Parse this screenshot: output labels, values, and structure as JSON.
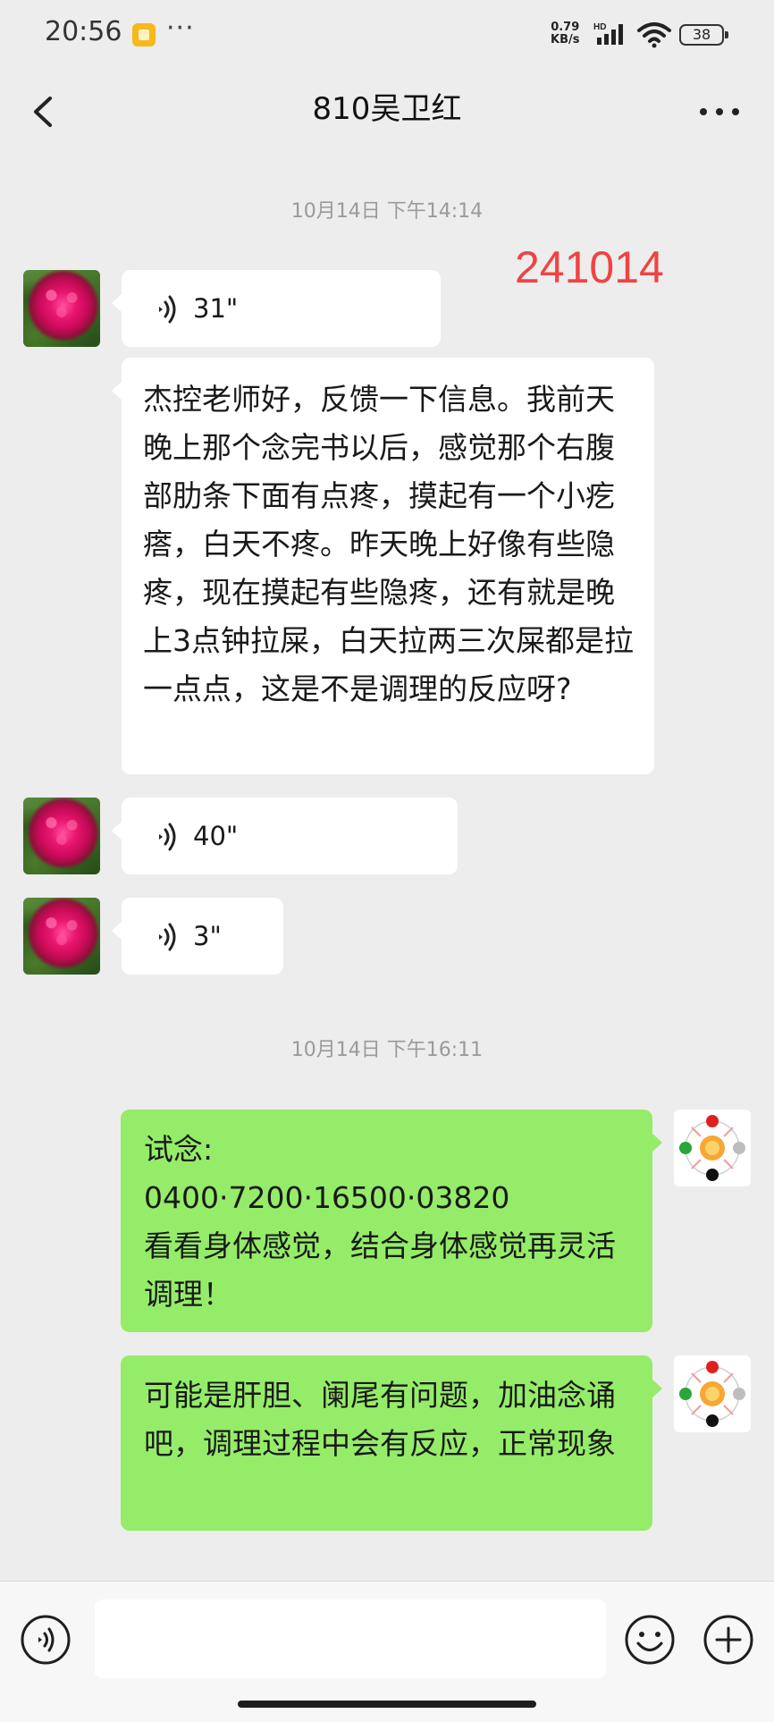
{
  "status_bar": {
    "time": "20:56",
    "dots": "···",
    "net_speed_value": "0.79",
    "net_speed_unit": "KB/s",
    "net_type": "HD",
    "battery": "38"
  },
  "header": {
    "title": "810吴卫红",
    "back_icon": "chevron-left-icon",
    "more_icon": "more-horizontal-icon"
  },
  "annotation": "241014",
  "messages": [
    {
      "type": "timestamp",
      "text": "10月14日 下午14:14"
    },
    {
      "type": "voice",
      "side": "incoming",
      "duration": "31\""
    },
    {
      "type": "text",
      "side": "incoming",
      "text": "杰控老师好，反馈一下信息。我前天晚上那个念完书以后，感觉那个右腹部肋条下面有点疼，摸起有一个小疙瘩，白天不疼。昨天晚上好像有些隐疼，现在摸起有些隐疼，还有就是晚上3点钟拉屎，白天拉两三次屎都是拉一点点，这是不是调理的反应呀?"
    },
    {
      "type": "voice",
      "side": "incoming",
      "duration": "40\""
    },
    {
      "type": "voice",
      "side": "incoming",
      "duration": "3\""
    },
    {
      "type": "timestamp",
      "text": "10月14日 下午16:11"
    },
    {
      "type": "text",
      "side": "outgoing",
      "text": "试念:\n0400·7200·16500·03820\n看看身体感觉，结合身体感觉再灵活调理！"
    },
    {
      "type": "text",
      "side": "outgoing",
      "text": "可能是肝胆、阑尾有问题，加油念诵吧，调理过程中会有反应，正常现象"
    }
  ],
  "input_bar": {
    "input_value": "",
    "voice_icon": "voice-mode-icon",
    "emoji_icon": "emoji-icon",
    "add_icon": "plus-circle-icon"
  },
  "colors": {
    "background": "#ededed",
    "incoming_bubble": "#ffffff",
    "outgoing_bubble": "#95ec69",
    "annotation": "#f04343"
  }
}
